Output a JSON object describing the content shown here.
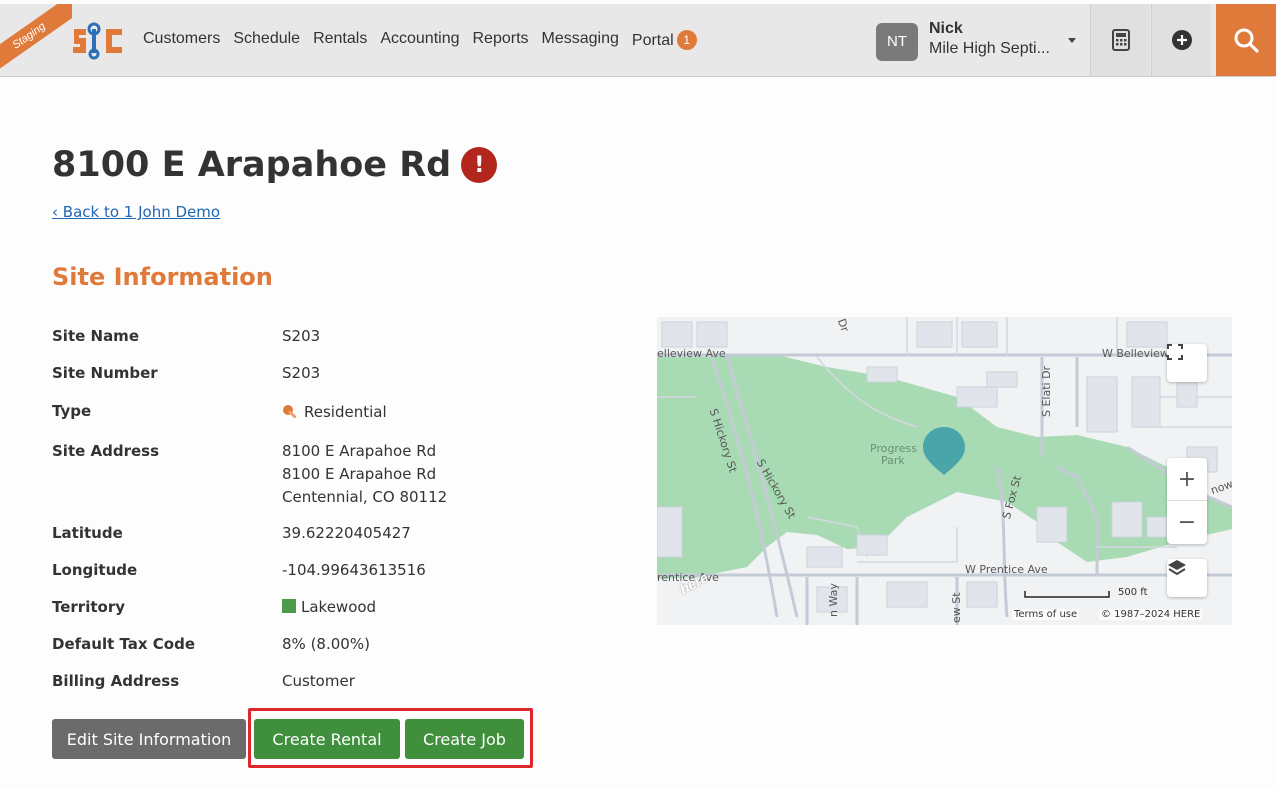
{
  "header": {
    "staging_label": "Staging",
    "nav_items": [
      "Customers",
      "Schedule",
      "Rentals",
      "Accounting",
      "Reports",
      "Messaging",
      "Portal"
    ],
    "portal_badge": "1",
    "user": {
      "initials": "NT",
      "name": "Nick",
      "org": "Mile High Septi..."
    },
    "icons": {
      "calculator": "calculator-icon",
      "add": "plus-circle-icon",
      "search": "search-icon"
    },
    "accent_color": "#e07a3a"
  },
  "page": {
    "title": "8100 E Arapahoe Rd",
    "alert_icon": "!",
    "back_link": "Back to 1 John Demo",
    "section_title": "Site Information"
  },
  "site_info": {
    "site_name": {
      "label": "Site Name",
      "value": "S203"
    },
    "site_number": {
      "label": "Site Number",
      "value": "S203"
    },
    "type": {
      "label": "Type",
      "value": "Residential",
      "icon": "pin-icon"
    },
    "site_address": {
      "label": "Site Address",
      "line1": "8100 E Arapahoe Rd",
      "line2": "8100 E Arapahoe Rd",
      "line3": "Centennial, CO 80112"
    },
    "latitude": {
      "label": "Latitude",
      "value": "39.62220405427"
    },
    "longitude": {
      "label": "Longitude",
      "value": "-104.99643613516"
    },
    "territory": {
      "label": "Territory",
      "value": "Lakewood",
      "color": "#4c9a4c"
    },
    "default_tax_code": {
      "label": "Default Tax Code",
      "value": "8% (8.00%)"
    },
    "billing_address": {
      "label": "Billing Address",
      "value": "Customer"
    }
  },
  "actions": {
    "edit": "Edit Site Information",
    "create_rental": "Create Rental",
    "create_job": "Create Job"
  },
  "map": {
    "labels": {
      "belleview_w": "elleview Ave",
      "belleview_e": "W Belleview",
      "hickory1": "S Hickory St",
      "hickory2": "S Hickory St",
      "elati": "S Elati Dr",
      "fox": "S Fox St",
      "park": "Progress",
      "park2": "Park",
      "prentice_w": "rentice Ave",
      "prentice_e": "W Prentice Ave",
      "snow": "now A",
      "way": "n Way",
      "ew_st": "ew St",
      "dr": "Dr"
    },
    "scale": "500 ft",
    "terms": "Terms of use",
    "copyright": "© 1987–2024 HERE",
    "brand": "here",
    "zoom_in": "+",
    "zoom_out": "−"
  }
}
